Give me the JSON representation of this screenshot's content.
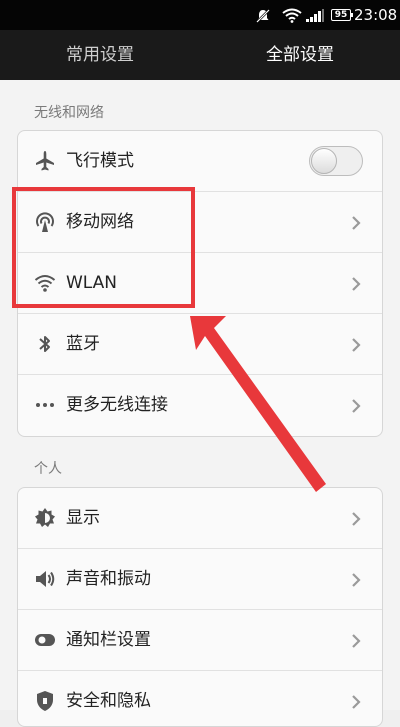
{
  "status_bar": {
    "battery": "95",
    "time": "23:08",
    "icons": [
      "notification-off-icon",
      "wifi-icon",
      "signal-icon",
      "battery-icon"
    ]
  },
  "tabs": [
    {
      "label": "常用设置",
      "active": false
    },
    {
      "label": "全部设置",
      "active": true
    }
  ],
  "sections": [
    {
      "title": "无线和网络",
      "items": [
        {
          "label": "飞行模式",
          "icon": "airplane-icon",
          "control": "toggle",
          "value": false
        },
        {
          "label": "移动网络",
          "icon": "mobile-network-icon",
          "control": "chevron"
        },
        {
          "label": "WLAN",
          "icon": "wifi-icon",
          "control": "chevron"
        },
        {
          "label": "蓝牙",
          "icon": "bluetooth-icon",
          "control": "chevron"
        },
        {
          "label": "更多无线连接",
          "icon": "more-dots-icon",
          "control": "chevron"
        }
      ]
    },
    {
      "title": "个人",
      "items": [
        {
          "label": "显示",
          "icon": "brightness-icon",
          "control": "chevron"
        },
        {
          "label": "声音和振动",
          "icon": "speaker-icon",
          "control": "chevron"
        },
        {
          "label": "通知栏设置",
          "icon": "notification-toggle-icon",
          "control": "chevron"
        },
        {
          "label": "安全和隐私",
          "icon": "shield-icon",
          "control": "chevron"
        }
      ]
    }
  ],
  "colors": {
    "highlight": "#e8383b",
    "header_bg": "#1a1a1a",
    "status_bg": "#050505"
  }
}
